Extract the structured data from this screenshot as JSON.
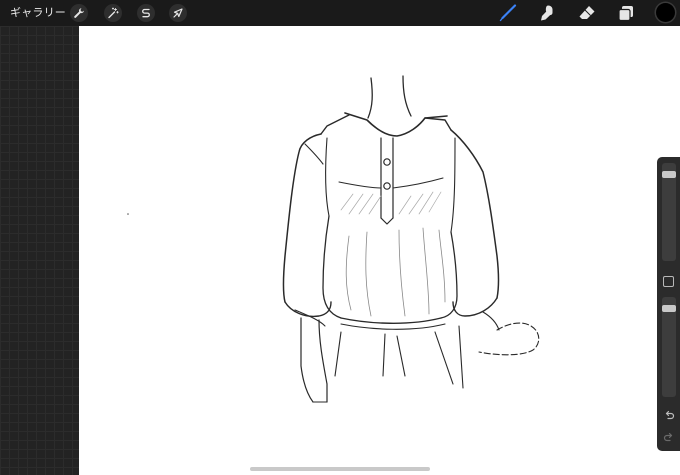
{
  "topbar": {
    "gallery_label": "ギャラリー",
    "left_tools": [
      {
        "name": "actions",
        "icon": "wrench-icon"
      },
      {
        "name": "adjustments",
        "icon": "magic-wand-icon"
      },
      {
        "name": "selection",
        "icon": "selection-s-icon"
      },
      {
        "name": "transform",
        "icon": "arrow-cursor-icon"
      }
    ],
    "right_tools": [
      {
        "name": "brush",
        "icon": "brush-icon",
        "active": true,
        "active_color": "#3b82f6"
      },
      {
        "name": "smudge",
        "icon": "smudge-finger-icon"
      },
      {
        "name": "eraser",
        "icon": "eraser-icon"
      },
      {
        "name": "layers",
        "icon": "layers-icon"
      }
    ],
    "current_color": "#000000"
  },
  "sidebar": {
    "brush_size_level": 0.05,
    "opacity_level": 0.05,
    "modify_icon": "square-icon",
    "undo_icon": "undo-arrow-icon",
    "redo_icon": "redo-arrow-icon"
  },
  "canvas": {
    "background": "#ffffff",
    "content": "pencil-sketch"
  }
}
